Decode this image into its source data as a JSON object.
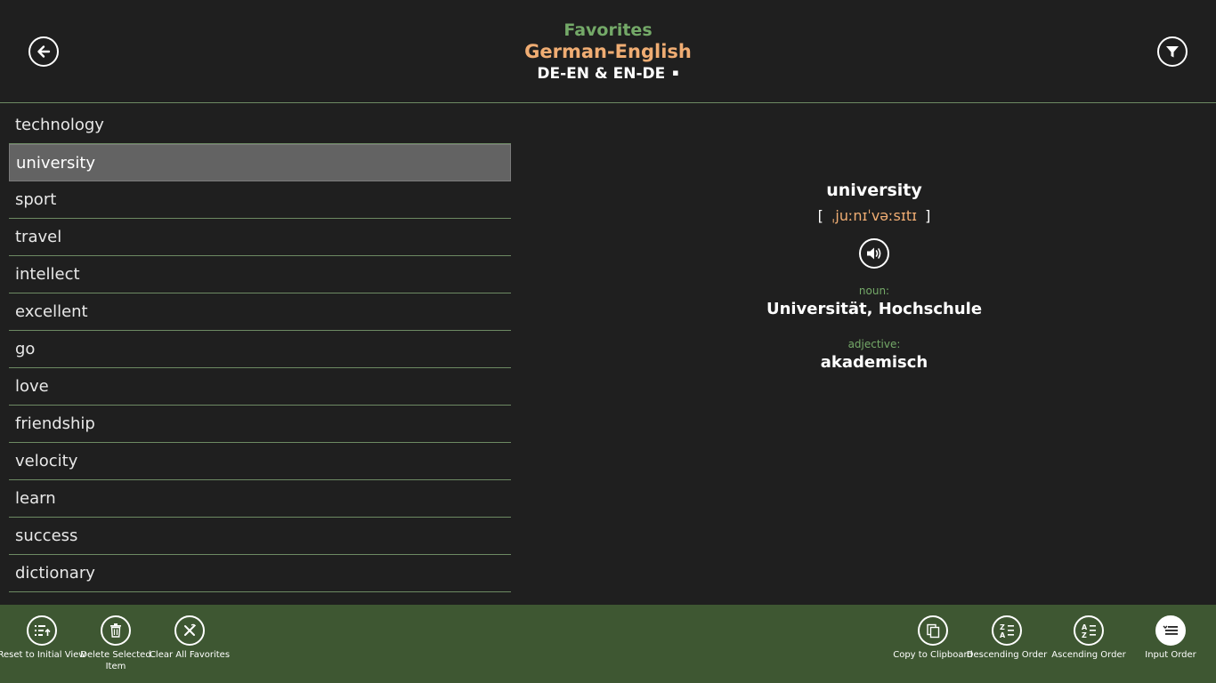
{
  "header": {
    "title_section": "Favorites",
    "title_language": "German-English",
    "title_direction": "DE-EN & EN-DE",
    "direction_indicator": "▪"
  },
  "word_list": {
    "selected_index": 1,
    "items": [
      "technology",
      "university",
      "sport",
      "travel",
      "intellect",
      "excellent",
      "go",
      "love",
      "friendship",
      "velocity",
      "learn",
      "success",
      "dictionary"
    ]
  },
  "detail": {
    "word": "university",
    "bracket_open": "[",
    "pronunciation": "ˌjuːnɪˈvəːsɪtɪ",
    "bracket_close": "]",
    "entries": [
      {
        "pos": "noun:",
        "translation": "Universität, Hochschule"
      },
      {
        "pos": "adjective:",
        "translation": "akademisch"
      }
    ]
  },
  "appbar": {
    "reset": "Reset to Initial View",
    "delete": "Delete Selected Item",
    "clear": "Clear All Favorites",
    "copy": "Copy to Clipboard",
    "descending": "Descending Order",
    "ascending": "Ascending Order",
    "input_order": "Input Order"
  },
  "colors": {
    "accent_green": "#74a968",
    "accent_orange": "#f0ad73",
    "appbar_bg": "#3e5732",
    "background": "#1f1f1f"
  }
}
